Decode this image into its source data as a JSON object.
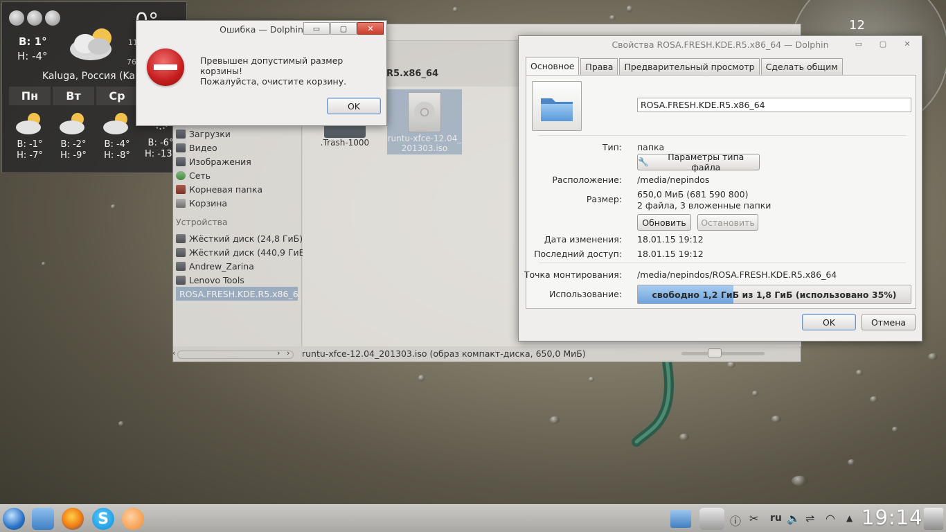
{
  "weather": {
    "high": "В: 1°",
    "low": "Н: -4°",
    "current_temp": "0°",
    "line_11": "11",
    "pressure": "764 м",
    "location": "Kaluga, Россия (Kalug",
    "days": [
      {
        "name": "Пн",
        "high": "В: -1°",
        "low": "Н: -7°"
      },
      {
        "name": "Вт",
        "high": "В: -2°",
        "low": "Н: -9°"
      },
      {
        "name": "Ср",
        "high": "В: -4°",
        "low": "Н: -8°"
      },
      {
        "name": "",
        "high": "В: -6°",
        "low": "Н: -13°"
      }
    ]
  },
  "dolphin": {
    "breadcrumb": "R5.x86_64",
    "places": {
      "items": [
        {
          "label": "Загрузки"
        },
        {
          "label": "Видео"
        },
        {
          "label": "Изображения"
        },
        {
          "label": "Сеть"
        },
        {
          "label": "Корневая папка"
        },
        {
          "label": "Корзина"
        }
      ],
      "devices_header": "Устройства",
      "devices": [
        {
          "label": "Жёсткий диск (24,8 ГиБ)"
        },
        {
          "label": "Жёсткий диск (440,9 ГиБ)"
        },
        {
          "label": "Andrew_Zarina"
        },
        {
          "label": "Lenovo Tools"
        },
        {
          "label": "ROSA.FRESH.KDE.R5.x86_6"
        }
      ]
    },
    "files": [
      {
        "name": ".Trash-1000"
      },
      {
        "name": "runtu-xfce-12.04_",
        "name2": "201303.iso"
      }
    ],
    "status": "runtu-xfce-12.04_201303.iso (образ компакт-диска, 650,0 МиБ)"
  },
  "error_dialog": {
    "title": "Ошибка — Dolphin",
    "message_line1": "Превышен допустимый размер корзины!",
    "message_line2": "Пожалуйста, очистите корзину.",
    "ok_label": "OK",
    "buttons": {
      "minimize": "▭",
      "maximize": "▢",
      "close": "✕"
    }
  },
  "properties_dialog": {
    "title": "Свойства ROSA.FRESH.KDE.R5.x86_64 — Dolphin",
    "tabs": [
      "Основное",
      "Права",
      "Предварительный просмотр",
      "Сделать общим"
    ],
    "name_value": "ROSA.FRESH.KDE.R5.x86_64",
    "type_label": "Тип:",
    "type_value": "папка",
    "filetype_button": "Параметры типа файла",
    "location_label": "Расположение:",
    "location_value": "/media/nepindos",
    "size_label": "Размер:",
    "size_value": "650,0 МиБ (681 590 800)",
    "size_detail": "2 файла, 3 вложенные папки",
    "refresh_button": "Обновить",
    "stop_button": "Остановить",
    "modified_label": "Дата изменения:",
    "modified_value": "18.01.15 19:12",
    "accessed_label": "Последний доступ:",
    "accessed_value": "18.01.15 19:12",
    "mount_label": "Точка монтирования:",
    "mount_value": "/media/nepindos/ROSA.FRESH.KDE.R5.x86_64",
    "usage_label": "Использование:",
    "usage_text": "свободно 1,2 ГиБ из 1,8 ГиБ (использовано 35%)",
    "usage_percent": 35,
    "ok_label": "OK",
    "cancel_label": "Отмена"
  },
  "clock_widget": {
    "hour_mark": "12"
  },
  "taskbar": {
    "language": "ru",
    "time": "19:14"
  },
  "colors": {
    "accent": "#6ea3dc",
    "close_button": "#c83d2b",
    "error_icon": "#c41d1d"
  }
}
